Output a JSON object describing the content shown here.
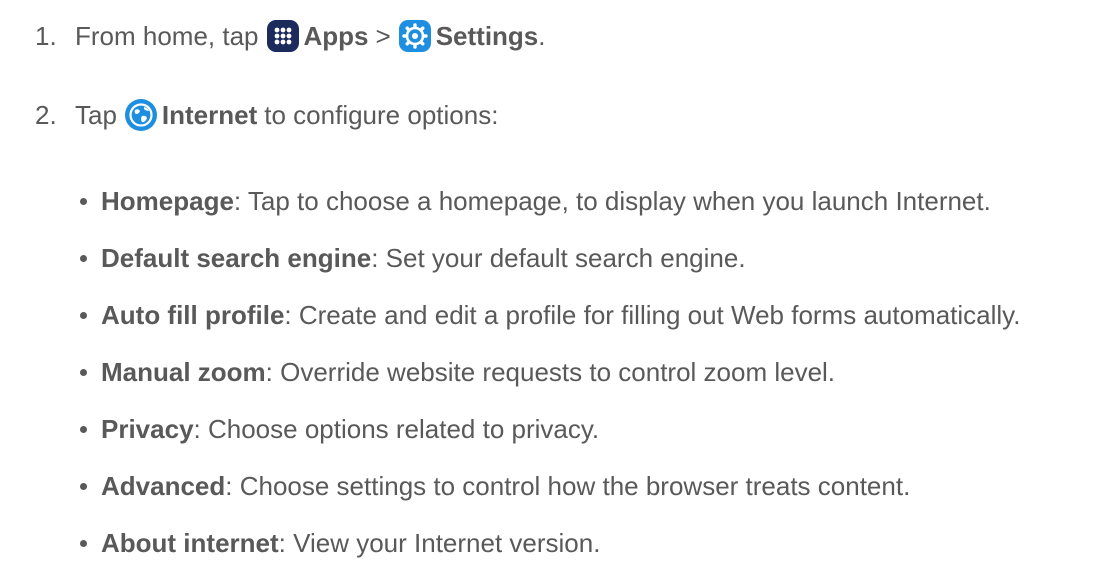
{
  "steps": [
    {
      "number": "1.",
      "pre": "From home, tap",
      "apps_icon": "apps-grid-icon",
      "apps_label": "Apps",
      "sep": ">",
      "settings_icon": "settings-gear-icon",
      "settings_label": "Settings",
      "post": "."
    },
    {
      "number": "2.",
      "pre": "Tap",
      "internet_icon": "internet-globe-icon",
      "internet_label": "Internet",
      "post": "to configure options:"
    }
  ],
  "options": [
    {
      "term": "Homepage",
      "desc": ": Tap to choose a homepage, to display when you launch Internet."
    },
    {
      "term": "Default search engine",
      "desc": ": Set your default search engine."
    },
    {
      "term": "Auto fill profile",
      "desc": ": Create and edit a profile for filling out Web forms automatically."
    },
    {
      "term": "Manual zoom",
      "desc": ": Override website requests to control zoom level."
    },
    {
      "term": "Privacy",
      "desc": ": Choose options related to privacy."
    },
    {
      "term": "Advanced",
      "desc": ": Choose settings to control how the browser treats content."
    },
    {
      "term": "About internet",
      "desc": ": View your Internet version."
    }
  ],
  "colors": {
    "text": "#595959",
    "apps_icon_bg": "#1d2b5c",
    "settings_icon_bg": "#1e8fe0",
    "internet_icon_bg": "#1e8fe0"
  }
}
